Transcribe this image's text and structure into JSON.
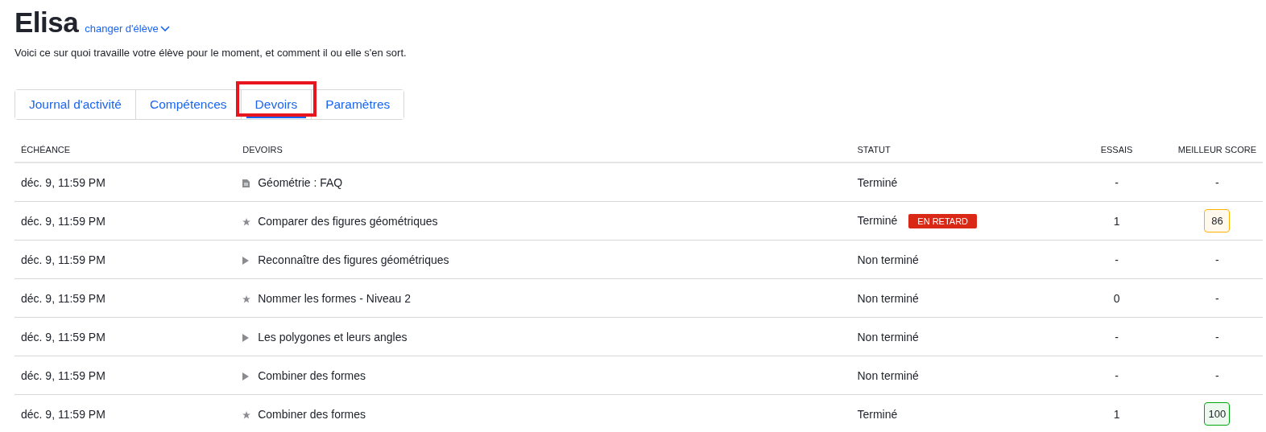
{
  "student": {
    "name": "Elisa",
    "switch_link": "changer d'élève"
  },
  "description": "Voici ce sur quoi travaille votre élève pour le moment, et comment il ou elle s'en sort.",
  "tabs": [
    {
      "label": "Journal d'activité",
      "selected": false,
      "highlighted": false
    },
    {
      "label": "Compétences",
      "selected": false,
      "highlighted": false
    },
    {
      "label": "Devoirs",
      "selected": true,
      "highlighted": true
    },
    {
      "label": "Paramètres",
      "selected": false,
      "highlighted": false
    }
  ],
  "table": {
    "columns": [
      "ÉCHÉANCE",
      "DEVOIRS",
      "STATUT",
      "ESSAIS",
      "MEILLEUR SCORE"
    ],
    "rows": [
      {
        "due": "déc. 9, 11:59 PM",
        "kind": "article",
        "title": "Géométrie : FAQ",
        "status": "Terminé",
        "late": false,
        "attempts": "-",
        "score": "-"
      },
      {
        "due": "déc. 9, 11:59 PM",
        "kind": "exercise",
        "title": "Comparer des figures géométriques",
        "status": "Terminé",
        "late": true,
        "late_label": "EN RETARD",
        "attempts": "1",
        "score": "86",
        "color": "#ffb100"
      },
      {
        "due": "déc. 9, 11:59 PM",
        "kind": "video",
        "title": "Reconnaître des figures géométriques",
        "status": "Non terminé",
        "late": false,
        "attempts": "-",
        "score": "-"
      },
      {
        "due": "déc. 9, 11:59 PM",
        "kind": "exercise",
        "title": "Nommer les formes - Niveau 2",
        "status": "Non terminé",
        "late": false,
        "attempts": "0",
        "score": "-"
      },
      {
        "due": "déc. 9, 11:59 PM",
        "kind": "video",
        "title": "Les polygones et leurs angles",
        "status": "Non terminé",
        "late": false,
        "attempts": "-",
        "score": "-"
      },
      {
        "due": "déc. 9, 11:59 PM",
        "kind": "video",
        "title": "Combiner des formes",
        "status": "Non terminé",
        "late": false,
        "attempts": "-",
        "score": "-"
      },
      {
        "due": "déc. 9, 11:59 PM",
        "kind": "exercise",
        "title": "Combiner des formes",
        "status": "Terminé",
        "late": false,
        "attempts": "1",
        "score": "100",
        "color": "#00a60e"
      }
    ]
  }
}
